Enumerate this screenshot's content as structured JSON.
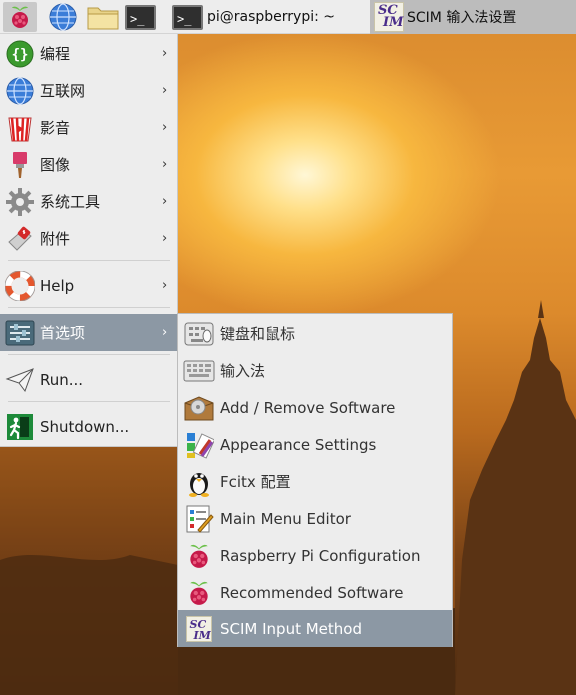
{
  "panel": {
    "terminal_task_label": "pi@raspberrypi: ~",
    "scim_task_label": "SCIM 输入法设置",
    "scim_icon_text_top": "SC",
    "scim_icon_text_bottom": "IM"
  },
  "menu": {
    "items": [
      {
        "label": "编程",
        "icon": "programming-icon"
      },
      {
        "label": "互联网",
        "icon": "internet-globe-icon"
      },
      {
        "label": "影音",
        "icon": "sound-video-icon"
      },
      {
        "label": "图像",
        "icon": "graphics-brush-icon"
      },
      {
        "label": "系统工具",
        "icon": "system-gear-icon"
      },
      {
        "label": "附件",
        "icon": "accessories-knife-icon"
      },
      {
        "label": "Help",
        "icon": "help-lifebuoy-icon"
      },
      {
        "label": "首选项",
        "icon": "preferences-icon"
      },
      {
        "label": "Run...",
        "icon": "run-paper-plane-icon"
      },
      {
        "label": "Shutdown...",
        "icon": "shutdown-exit-icon"
      }
    ],
    "arrow": "›"
  },
  "submenu": {
    "items": [
      {
        "label": "键盘和鼠标",
        "icon": "keyboard-mouse-icon"
      },
      {
        "label": "输入法",
        "icon": "input-method-keyboard-icon"
      },
      {
        "label": "Add / Remove Software",
        "icon": "package-box-icon"
      },
      {
        "label": "Appearance Settings",
        "icon": "appearance-palette-icon"
      },
      {
        "label": "Fcitx 配置",
        "icon": "penguin-icon"
      },
      {
        "label": "Main Menu Editor",
        "icon": "menu-editor-icon"
      },
      {
        "label": "Raspberry Pi Configuration",
        "icon": "raspberry-icon"
      },
      {
        "label": "Recommended Software",
        "icon": "raspberry-icon"
      },
      {
        "label": "SCIM Input Method",
        "icon": "scim-icon"
      }
    ]
  },
  "colors": {
    "panel_bg": "#ededed",
    "menu_selected_bg": "#8c98a4",
    "raspberry_red": "#c51a4a",
    "raspberry_leaf": "#6cc04a"
  }
}
